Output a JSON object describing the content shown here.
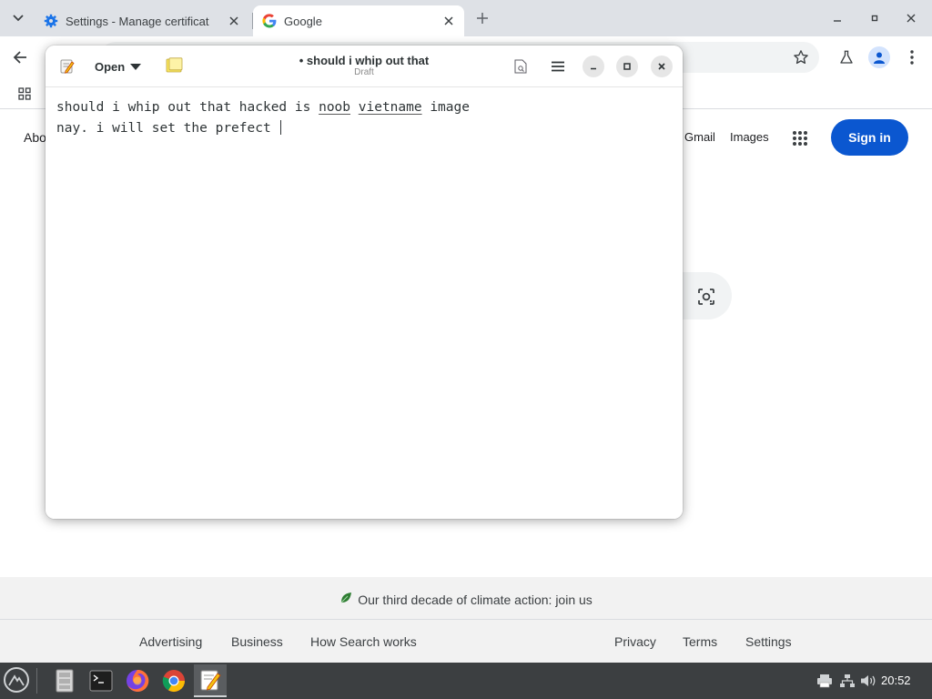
{
  "browser": {
    "tabs": [
      {
        "title": "Settings - Manage certificat",
        "active": false
      },
      {
        "title": "Google",
        "active": true
      }
    ]
  },
  "google": {
    "about_label": "Abo",
    "gmail_label": "Gmail",
    "images_label": "Images",
    "signin_label": "Sign in",
    "climate_text": "Our third decade of climate action: join us",
    "footer_left": [
      "Advertising",
      "Business",
      "How Search works"
    ],
    "footer_right": [
      "Privacy",
      "Terms",
      "Settings"
    ]
  },
  "editor": {
    "open_label": "Open",
    "title": "• should i whip out that",
    "subtitle": "Draft",
    "lines": {
      "line1_pre": "should i whip out that hacked is ",
      "line1_word1": "noob",
      "line1_mid": " ",
      "line1_word2": "vietname",
      "line1_post": " image",
      "line2": "nay. i will set the prefect "
    }
  },
  "taskbar": {
    "clock": "20:52"
  },
  "colors": {
    "signin_bg": "#0b57d0",
    "taskbar_bg": "#3c3f41",
    "tabstrip_bg": "#dee1e6"
  }
}
